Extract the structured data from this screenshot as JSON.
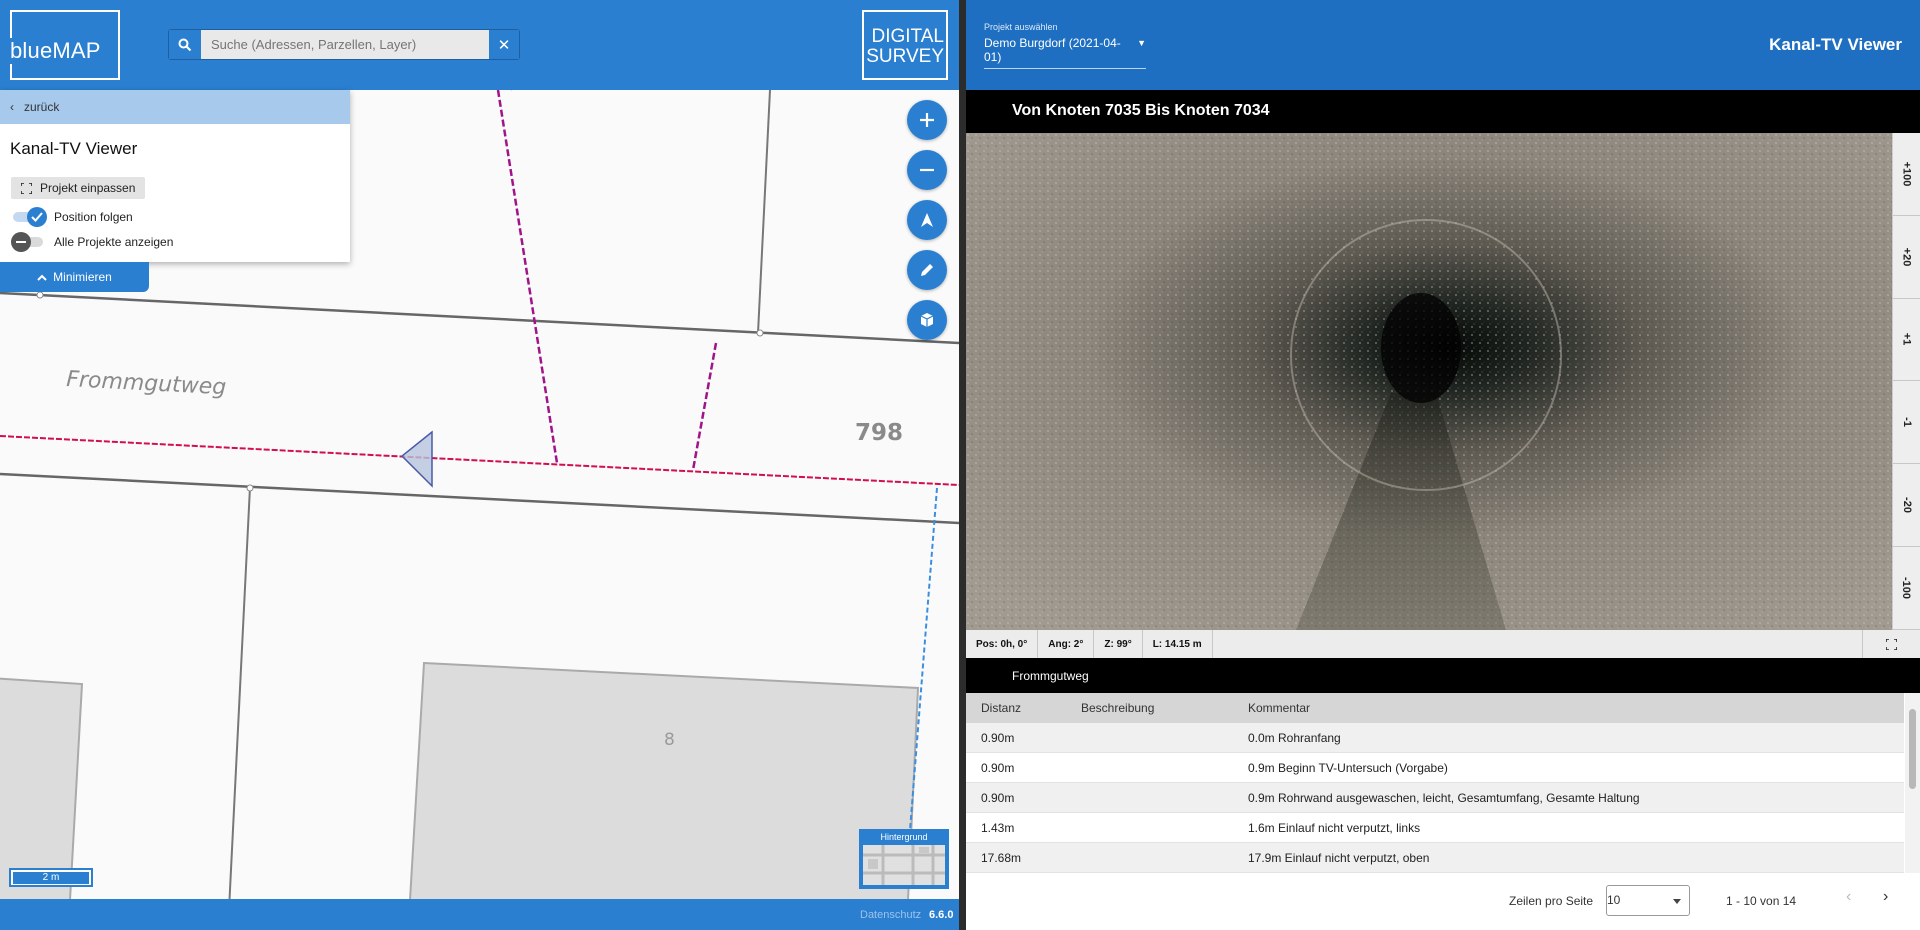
{
  "map": {
    "logo": "blueMAP",
    "search_placeholder": "Suche (Adressen, Parzellen, Layer)",
    "ds_logo_line1": "DIGITAL",
    "ds_logo_line2": "SURVEY",
    "street_label": "Frommgutweg",
    "parcel_number": "798",
    "building_number": "8",
    "scale": "2 m",
    "background_label": "Hintergrund",
    "footer_privacy": "Datenschutz",
    "footer_version": "6.6.0",
    "icons": {
      "zoom_in": "plus-icon",
      "zoom_out": "minus-icon",
      "locate": "navigation-arrow-icon",
      "measure": "pencil-icon",
      "view3d": "cube-icon"
    }
  },
  "panel": {
    "back": "zurück",
    "title": "Kanal-TV Viewer",
    "fit_button": "Projekt einpassen",
    "follow_label": "Position folgen",
    "follow_on": true,
    "all_projects_label": "Alle Projekte anzeigen",
    "all_projects_on": false,
    "minimize": "Minimieren"
  },
  "viewer": {
    "project_label": "Projekt auswählen",
    "project_value": "Demo Burgdorf (2021-04-01)",
    "title": "Kanal-TV Viewer",
    "header": "Von Knoten 7035 Bis Knoten 7034",
    "zoom_steps": [
      "+100",
      "+20",
      "+1",
      "-1",
      "-20",
      "-100"
    ],
    "status": {
      "pos": "Pos: 0h, 0°",
      "ang": "Ang: 2°",
      "z": "Z: 99°",
      "l": "L: 14.15 m"
    },
    "street": "Frommgutweg",
    "table": {
      "headers": [
        "Distanz",
        "Beschreibung",
        "Kommentar"
      ],
      "rows": [
        [
          "0.90m",
          "",
          "0.0m Rohranfang"
        ],
        [
          "0.90m",
          "",
          "0.9m Beginn TV-Untersuch (Vorgabe)"
        ],
        [
          "0.90m",
          "",
          "0.9m Rohrwand ausgewaschen, leicht, Gesamtumfang, Gesamte Haltung"
        ],
        [
          "1.43m",
          "",
          "1.6m Einlauf nicht verputzt, links"
        ],
        [
          "17.68m",
          "",
          "17.9m Einlauf nicht verputzt, oben"
        ]
      ]
    },
    "pager": {
      "rows_label": "Zeilen pro Seite",
      "rows_value": "10",
      "range": "1 - 10 von 14"
    },
    "colors": {
      "brand": "#2a7fd1",
      "header_dark": "#1e6fc1"
    }
  }
}
